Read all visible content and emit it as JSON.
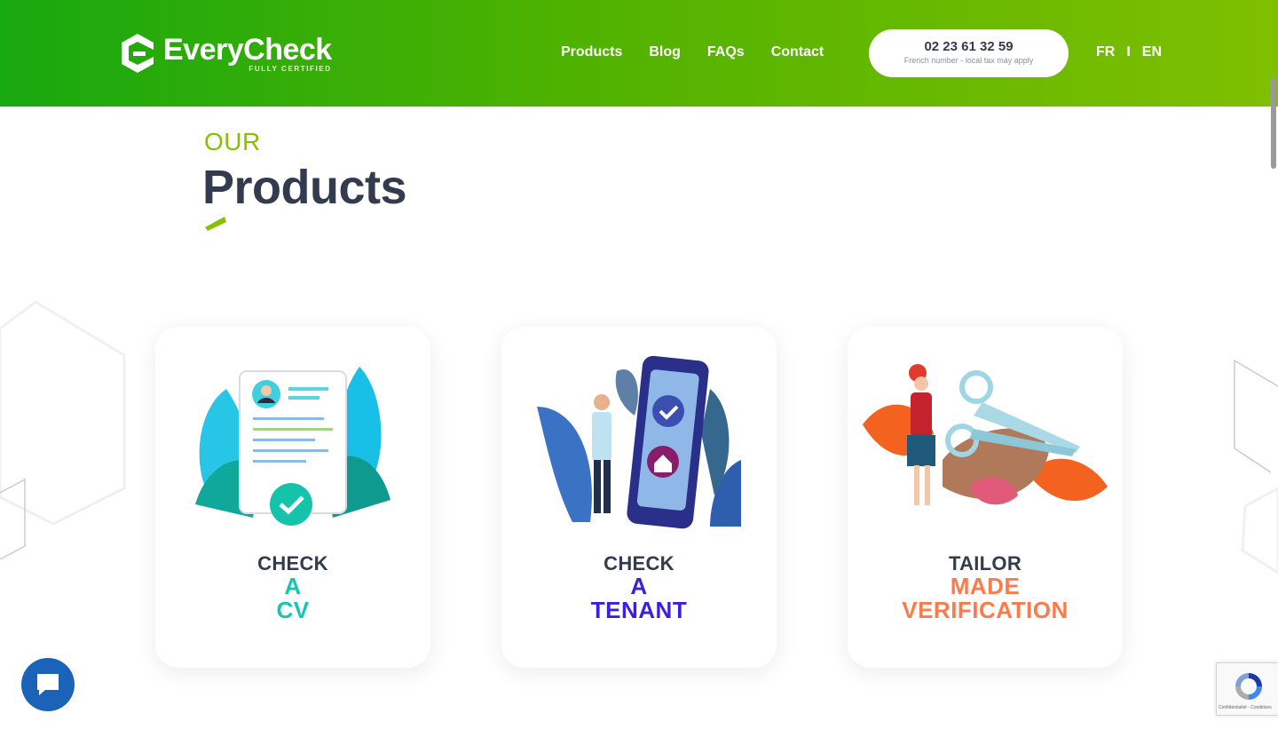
{
  "header": {
    "logo_name": "EveryCheck",
    "logo_tagline": "FULLY CERTIFIED",
    "nav": [
      "Products",
      "Blog",
      "FAQs",
      "Contact"
    ],
    "phone_number": "02 23 61 32 59",
    "phone_note": "French number - local tax may apply",
    "languages": [
      "FR",
      "I",
      "EN"
    ]
  },
  "section": {
    "eyebrow": "OUR",
    "title": "Products"
  },
  "cards": [
    {
      "line1": "CHECK",
      "line2": "A",
      "line3": "CV",
      "accent": "#16c7b0",
      "illustration": "cv-document-illustration"
    },
    {
      "line1": "CHECK",
      "line2": "A",
      "line3": "TENANT",
      "accent": "#3b1fe0",
      "illustration": "tenant-phone-illustration"
    },
    {
      "line1": "TAILOR",
      "line2": "MADE",
      "line3": "VERIFICATION",
      "accent": "#ff7a4a",
      "illustration": "tailor-scissors-illustration"
    }
  ],
  "chat": {
    "icon": "chat-bubble-icon"
  },
  "recaptcha": {
    "icon": "recaptcha-icon",
    "footer": "Confidentialité - Conditions"
  },
  "colors": {
    "header_start": "#18a80f",
    "header_end": "#7fbf00",
    "heading": "#333c4e",
    "eyebrow": "#86c100"
  }
}
